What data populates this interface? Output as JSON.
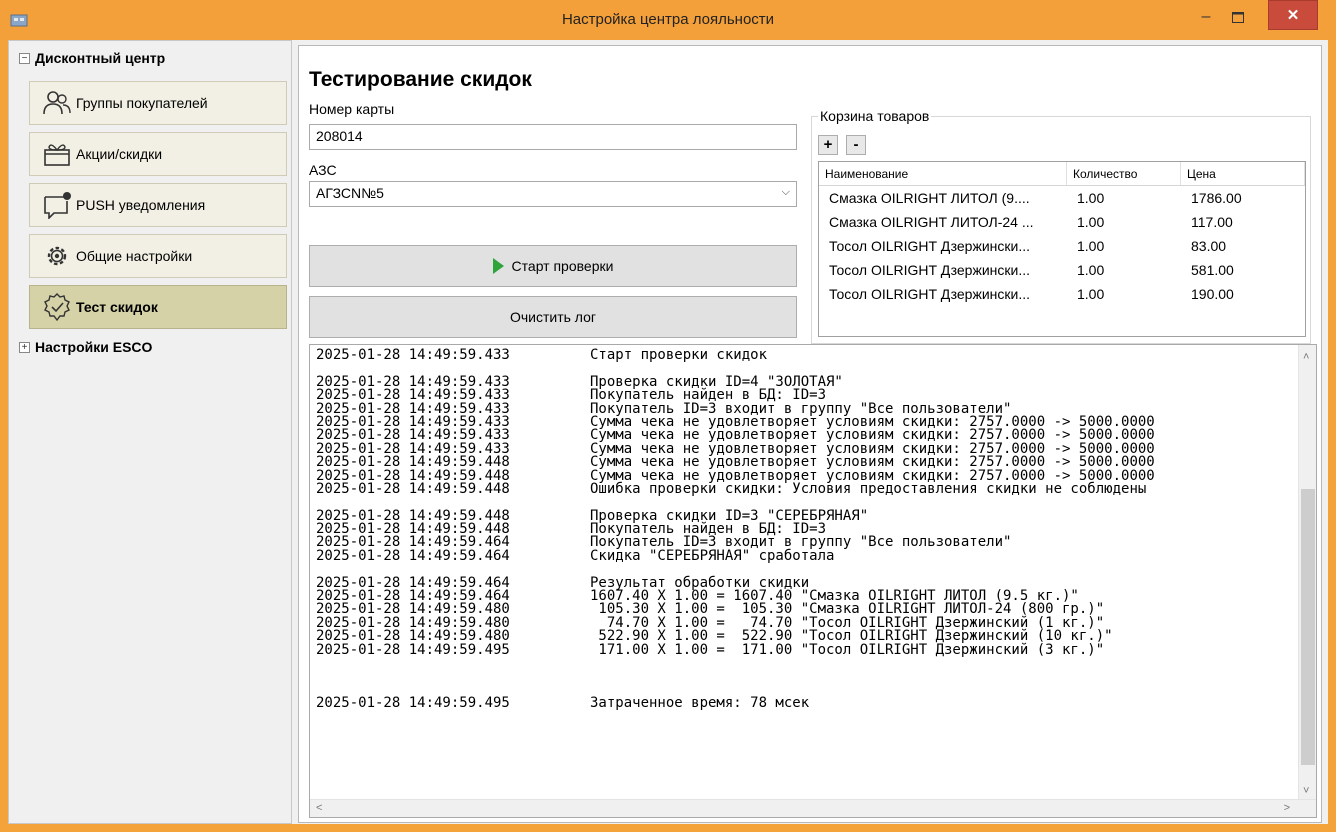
{
  "window": {
    "title": "Настройка центра лояльности"
  },
  "sidebar": {
    "group1": "Дисконтный центр",
    "items": [
      {
        "label": "Группы покупателей",
        "icon": "users-icon"
      },
      {
        "label": "Акции/скидки",
        "icon": "gift-icon"
      },
      {
        "label": "PUSH уведомления",
        "icon": "notification-icon"
      },
      {
        "label": "Общие настройки",
        "icon": "gear-icon"
      },
      {
        "label": "Тест скидок",
        "icon": "check-badge-icon",
        "active": true
      }
    ],
    "group2": "Настройки ESCO"
  },
  "main": {
    "title": "Тестирование скидок",
    "card_label": "Номер карты",
    "card_value": "208014",
    "azs_label": "АЗС",
    "azs_value": "АГЗСN№5",
    "start_button": "Старт проверки",
    "clear_button": "Очистить лог",
    "basket": {
      "label": "Корзина товаров",
      "add": "+",
      "remove": "-",
      "columns": [
        "Наименование",
        "Количество",
        "Цена"
      ],
      "rows": [
        [
          "Смазка OILRIGHT ЛИТОЛ (9....",
          "1.00",
          "1786.00"
        ],
        [
          "Смазка OILRIGHT ЛИТОЛ-24 ...",
          "1.00",
          "117.00"
        ],
        [
          "Тосол OILRIGHT Дзержински...",
          "1.00",
          "83.00"
        ],
        [
          "Тосол OILRIGHT Дзержински...",
          "1.00",
          "581.00"
        ],
        [
          "Тосол OILRIGHT Дзержински...",
          "1.00",
          "190.00"
        ]
      ]
    }
  },
  "log": [
    [
      "2025-01-28 14:49:59.433",
      "Старт проверки скидок"
    ],
    [],
    [
      "2025-01-28 14:49:59.433",
      "Проверка скидки ID=4 \"ЗОЛОТАЯ\""
    ],
    [
      "2025-01-28 14:49:59.433",
      "Покупатель найден в БД: ID=3"
    ],
    [
      "2025-01-28 14:49:59.433",
      "Покупатель ID=3 входит в группу \"Все пользователи\""
    ],
    [
      "2025-01-28 14:49:59.433",
      "Сумма чека не удовлетворяет условиям скидки: 2757.0000 -> 5000.0000"
    ],
    [
      "2025-01-28 14:49:59.433",
      "Сумма чека не удовлетворяет условиям скидки: 2757.0000 -> 5000.0000"
    ],
    [
      "2025-01-28 14:49:59.433",
      "Сумма чека не удовлетворяет условиям скидки: 2757.0000 -> 5000.0000"
    ],
    [
      "2025-01-28 14:49:59.448",
      "Сумма чека не удовлетворяет условиям скидки: 2757.0000 -> 5000.0000"
    ],
    [
      "2025-01-28 14:49:59.448",
      "Сумма чека не удовлетворяет условиям скидки: 2757.0000 -> 5000.0000"
    ],
    [
      "2025-01-28 14:49:59.448",
      "Ошибка проверки скидки: Условия предоставления скидки не соблюдены"
    ],
    [],
    [
      "2025-01-28 14:49:59.448",
      "Проверка скидки ID=3 \"СЕРЕБРЯНАЯ\""
    ],
    [
      "2025-01-28 14:49:59.448",
      "Покупатель найден в БД: ID=3"
    ],
    [
      "2025-01-28 14:49:59.464",
      "Покупатель ID=3 входит в группу \"Все пользователи\""
    ],
    [
      "2025-01-28 14:49:59.464",
      "Скидка \"СЕРЕБРЯНАЯ\" сработала"
    ],
    [],
    [
      "2025-01-28 14:49:59.464",
      "Результат обработки скидки"
    ],
    [
      "2025-01-28 14:49:59.464",
      "1607.40 X 1.00 = 1607.40 \"Смазка OILRIGHT ЛИТОЛ (9.5 кг.)\""
    ],
    [
      "2025-01-28 14:49:59.480",
      " 105.30 X 1.00 =  105.30 \"Смазка OILRIGHT ЛИТОЛ-24 (800 гр.)\""
    ],
    [
      "2025-01-28 14:49:59.480",
      "  74.70 X 1.00 =   74.70 \"Тосол OILRIGHT Дзержинский (1 кг.)\""
    ],
    [
      "2025-01-28 14:49:59.480",
      " 522.90 X 1.00 =  522.90 \"Тосол OILRIGHT Дзержинский (10 кг.)\""
    ],
    [
      "2025-01-28 14:49:59.495",
      " 171.00 X 1.00 =  171.00 \"Тосол OILRIGHT Дзержинский (3 кг.)\""
    ],
    [],
    [],
    [],
    [
      "2025-01-28 14:49:59.495",
      "Затраченное время: 78 мсек"
    ]
  ],
  "colors": {
    "titlebar": "#f3a03a",
    "close_button": "#c94b3c",
    "active_nav": "#d6d2a8",
    "play": "#2ea43a"
  }
}
